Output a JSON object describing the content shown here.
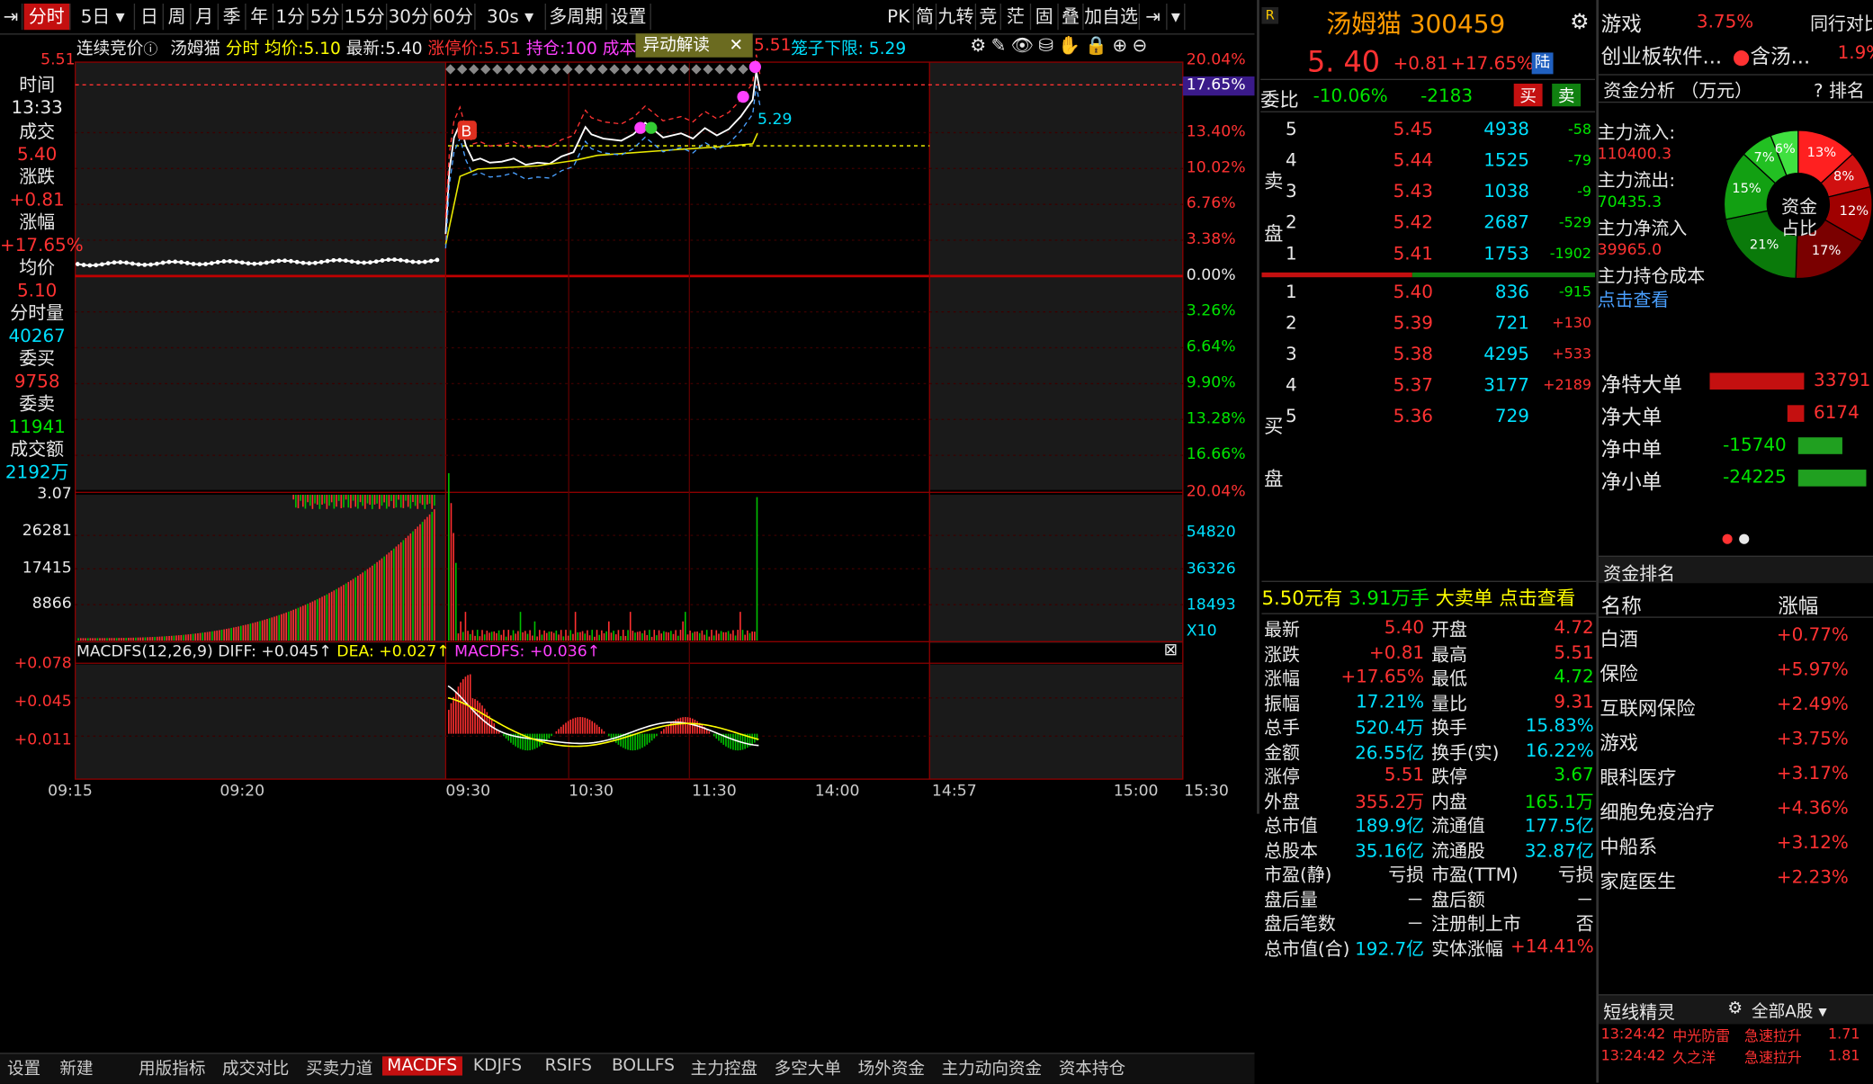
{
  "toolbar": {
    "items": [
      "分时",
      "5日",
      "日",
      "周",
      "月",
      "季",
      "年",
      "1分",
      "5分",
      "15分",
      "30分",
      "60分",
      "30s",
      "多周期",
      "设置"
    ],
    "right": [
      "PK",
      "简",
      "九转",
      "竞",
      "茫",
      "固",
      "叠",
      "加自选"
    ]
  },
  "header": {
    "auction": "连续竞价",
    "name": "汤姆猫",
    "mode": "分时",
    "avg_label": "均价:",
    "avg": "5.10",
    "last_label": "最新:",
    "last": "5.40",
    "limit_up": "涨停价:5.51",
    "hold": "持仓:100",
    "cost": "成本价:",
    "anomaly": "异动解读",
    "price_tag": "5.51",
    "cage": "笼子下限: 5.29"
  },
  "side": {
    "time_label": "时间",
    "time": "13:33",
    "deal_label": "成交",
    "deal": "5.40",
    "chg_label": "涨跌",
    "chg": "+0.81",
    "pct_label": "涨幅",
    "pct": "+17.65%",
    "avg_label": "均价",
    "avg": "5.10",
    "vol_label": "分时量",
    "vol": "40267",
    "bid_label": "委买",
    "bid": "9758",
    "ask_label": "委卖",
    "ask": "11941",
    "amt_label": "成交额",
    "amt": "2192万"
  },
  "axes": {
    "price_left": [
      "5.51"
    ],
    "pct_right": [
      "20.04%",
      "17.65%",
      "13.40%",
      "10.02%",
      "6.76%",
      "3.38%",
      "0.00%",
      "3.26%",
      "6.64%",
      "9.90%",
      "13.28%",
      "16.66%",
      "20.04%"
    ],
    "vol_left": [
      "3.07",
      "26281",
      "17415",
      "8866"
    ],
    "vol_right": [
      "54820",
      "36326",
      "18493",
      "X10"
    ],
    "macd_left": [
      "+0.078",
      "+0.045",
      "+0.011"
    ],
    "time": [
      "09:15",
      "09:20",
      "09:30",
      "10:30",
      "11:30",
      "14:00",
      "14:57",
      "15:00",
      "15:30"
    ]
  },
  "macd": {
    "label": "MACDFS(12,26,9)",
    "diff": "DIFF: +0.045↑",
    "dea": "DEA: +0.027↑",
    "macdfs": "MACDFS: +0.036↑"
  },
  "stock": {
    "r": "R",
    "name": "汤姆猫",
    "code": "300459",
    "price": "5. 40",
    "chg": "+0.81",
    "pct": "+17.65%",
    "tag": "陆",
    "ratio_label": "委比",
    "ratio": "-10.06%",
    "diff": "-2183",
    "buy": "买",
    "sell": "卖"
  },
  "asks": [
    {
      "l": "5",
      "p": "5.45",
      "v": "4938",
      "d": "-58"
    },
    {
      "l": "4",
      "p": "5.44",
      "v": "1525",
      "d": "-79"
    },
    {
      "l": "3",
      "p": "5.43",
      "v": "1038",
      "d": "-9"
    },
    {
      "l": "2",
      "p": "5.42",
      "v": "2687",
      "d": "-529"
    },
    {
      "l": "1",
      "p": "5.41",
      "v": "1753",
      "d": "-1902"
    }
  ],
  "bids": [
    {
      "l": "1",
      "p": "5.40",
      "v": "836",
      "d": "-915"
    },
    {
      "l": "2",
      "p": "5.39",
      "v": "721",
      "d": "+130"
    },
    {
      "l": "3",
      "p": "5.38",
      "v": "4295",
      "d": "+533"
    },
    {
      "l": "4",
      "p": "5.37",
      "v": "3177",
      "d": "+2189"
    },
    {
      "l": "5",
      "p": "5.36",
      "v": "729",
      "d": ""
    }
  ],
  "ask_side": "卖盘",
  "bid_side": "买盘",
  "order_note": {
    "price": "5.50元有",
    "vol": "3.91万手",
    "big": "大卖单",
    "link": "点击查看"
  },
  "stats": [
    [
      "最新",
      "5.40",
      "开盘",
      "4.72"
    ],
    [
      "涨跌",
      "+0.81",
      "最高",
      "5.51"
    ],
    [
      "涨幅",
      "+17.65%",
      "最低",
      "4.72"
    ],
    [
      "振幅",
      "17.21%",
      "量比",
      "9.31"
    ],
    [
      "总手",
      "520.4万",
      "换手",
      "15.83%"
    ],
    [
      "金额",
      "26.55亿",
      "换手(实)",
      "16.22%"
    ],
    [
      "涨停",
      "5.51",
      "跌停",
      "3.67"
    ],
    [
      "外盘",
      "355.2万",
      "内盘",
      "165.1万"
    ],
    [
      "总市值",
      "189.9亿",
      "流通值",
      "177.5亿"
    ],
    [
      "总股本",
      "35.16亿",
      "流通股",
      "32.87亿"
    ],
    [
      "市盈(静)",
      "亏损",
      "市盈(TTM)",
      "亏损"
    ],
    [
      "盘后量",
      "－",
      "盘后额",
      "－"
    ],
    [
      "盘后笔数",
      "－",
      "注册制上市",
      "否"
    ],
    [
      "总市值(合)",
      "192.7亿",
      "实体涨幅",
      "+14.41%"
    ]
  ],
  "sector": {
    "a": "游戏",
    "a_pct": "3.75%",
    "b": "同行对比",
    "c": "创业板软件...",
    "d": "含汤...",
    "d_pct": "1.9%"
  },
  "fund": {
    "title": "资金分析 （万元）",
    "rank": "? 排名",
    "in_l": "主力流入:",
    "in": "110400.3",
    "out_l": "主力流出:",
    "out": "70435.3",
    "net_l": "主力净流入",
    "net": "39965.0",
    "cost_l": "主力持仓成本",
    "link": "点击查看",
    "donut": "资金占比",
    "donut_b": "占比"
  },
  "donut_pcts": [
    "13%",
    "8%",
    "12%",
    "17%",
    "21%",
    "15%",
    "7%",
    "6%"
  ],
  "flows": [
    {
      "n": "净特大单",
      "v": "33791",
      "s": 1
    },
    {
      "n": "净大单",
      "v": "6174",
      "s": 1
    },
    {
      "n": "净中单",
      "v": "-15740",
      "s": -1
    },
    {
      "n": "净小单",
      "v": "-24225",
      "s": -1
    }
  ],
  "rank_title": "资金排名",
  "rank_head": [
    "名称",
    "涨幅"
  ],
  "ranks": [
    [
      "白酒",
      "+0.77%"
    ],
    [
      "保险",
      "+5.97%"
    ],
    [
      "互联网保险",
      "+2.49%"
    ],
    [
      "游戏",
      "+3.75%"
    ],
    [
      "眼科医疗",
      "+3.17%"
    ],
    [
      "细胞免疫治疗",
      "+4.36%"
    ],
    [
      "中船系",
      "+3.12%"
    ],
    [
      "家庭医生",
      "+2.23%"
    ]
  ],
  "sprite": {
    "title": "短线精灵",
    "filter": "全部A股",
    "rows": [
      [
        "13:24:42",
        "中光防雷",
        "急速拉升",
        "1.71"
      ],
      [
        "13:24:42",
        "久之洋",
        "急速拉升",
        "1.81"
      ]
    ]
  },
  "bottom_tabs": [
    "设置",
    "新建",
    "用版指标",
    "成交对比",
    "买卖力道",
    "MACDFS",
    "KDJFS",
    "RSIFS",
    "BOLLFS",
    "主力控盘",
    "多空大单",
    "场外资金",
    "主力动向资金",
    "资本持仓"
  ],
  "colors": {
    "up": "#ff3232",
    "down": "#00e600",
    "accent": "#c41010"
  }
}
